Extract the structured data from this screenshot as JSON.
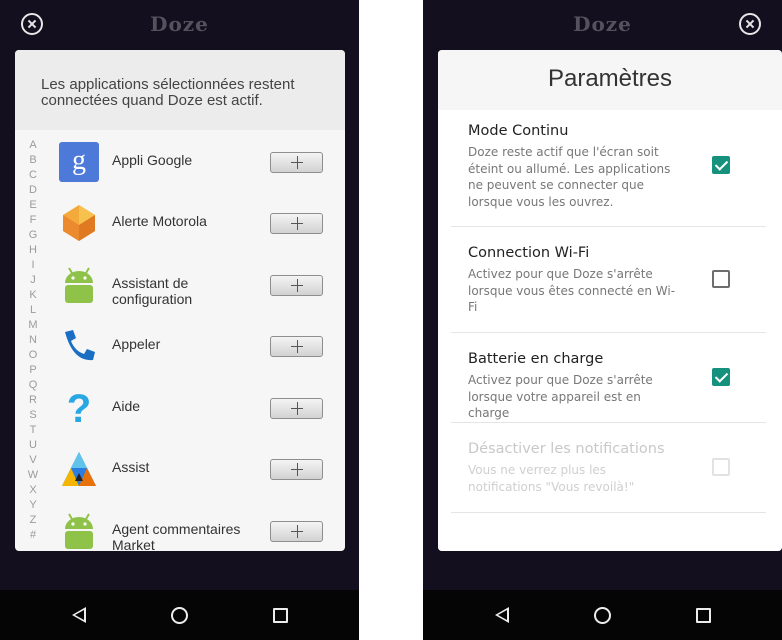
{
  "left": {
    "app_title": "Doze",
    "panel_header": "Les applications sélectionnées restent connectées quand Doze est actif.",
    "alphabet": [
      "A",
      "B",
      "C",
      "D",
      "E",
      "F",
      "G",
      "H",
      "I",
      "J",
      "K",
      "L",
      "M",
      "N",
      "O",
      "P",
      "Q",
      "R",
      "S",
      "T",
      "U",
      "V",
      "W",
      "X",
      "Y",
      "Z",
      "#"
    ],
    "apps": [
      {
        "name": "Appli Google",
        "icon": "google-icon"
      },
      {
        "name": "Alerte Motorola",
        "icon": "motorola-alert-icon"
      },
      {
        "name": "Assistant de configuration",
        "icon": "android-icon"
      },
      {
        "name": "Appeler",
        "icon": "phone-icon"
      },
      {
        "name": "Aide",
        "icon": "help-icon"
      },
      {
        "name": "Assist",
        "icon": "assist-icon"
      },
      {
        "name": "Agent commentaires Market",
        "icon": "android-icon"
      }
    ]
  },
  "right": {
    "app_title": "Doze",
    "settings_title": "Paramètres",
    "settings": [
      {
        "title": "Mode Continu",
        "description": "Doze reste actif que l'écran soit éteint ou allumé. Les applications ne peuvent se connecter que lorsque vous les ouvrez.",
        "checked": true,
        "enabled": true
      },
      {
        "title": "Connection Wi-Fi",
        "description": "Activez pour que Doze s'arrête lorsque vous êtes connecté en Wi-Fi",
        "checked": false,
        "enabled": true
      },
      {
        "title": "Batterie en charge",
        "description": "Activez pour que Doze s'arrête lorsque votre appareil est en charge",
        "checked": true,
        "enabled": true
      },
      {
        "title": "Désactiver les notifications",
        "description": "Vous ne verrez plus les notifications \"Vous revoilà!\"",
        "checked": false,
        "enabled": false
      }
    ]
  },
  "colors": {
    "accent": "#15917d",
    "background": "#130f1f",
    "navbar": "#050505"
  }
}
